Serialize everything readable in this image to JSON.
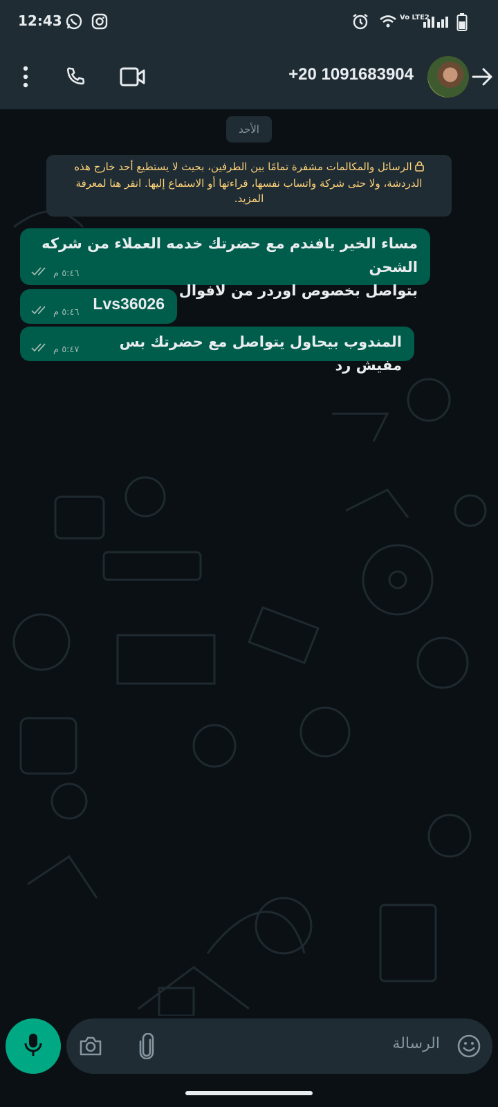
{
  "status_bar": {
    "time": "12:43",
    "left_icons": [
      "whatsapp-icon",
      "instagram-icon"
    ],
    "right_icons": [
      "alarm-icon",
      "wifi-icon",
      "volte-icon",
      "signal-icon",
      "battery-icon"
    ],
    "volte_label": "Vo LTE2"
  },
  "header": {
    "contact": "+20 1091683904",
    "icons": [
      "menu-icon",
      "call-icon",
      "video-call-icon",
      "avatar",
      "back-arrow-icon"
    ]
  },
  "chat": {
    "date_label": "الأحد",
    "encryption_notice": "الرسائل والمكالمات مشفرة تمامًا بين الطرفين، بحيث لا يستطيع أحد خارج هذه الدردشة، ولا حتى شركة واتساب نفسها، قراءتها أو الاستماع إليها. انقر هنا لمعرفة المزيد.",
    "messages": [
      {
        "line1": "مساء الخير يافندم مع حضرتك خدمه العملاء من شركه الشحن",
        "line2": "بتواصل بخصوص اوردر من لافوال",
        "time": "٥:٤٦ م"
      },
      {
        "line1": "Lvs36026",
        "time": "٥:٤٦ م"
      },
      {
        "line1": "المندوب بيحاول يتواصل مع حضرتك بس مفيش رد",
        "time": "٥:٤٧ م"
      }
    ]
  },
  "composer": {
    "placeholder": "الرسالة",
    "icons": [
      "mic-icon",
      "camera-icon",
      "attach-icon",
      "emoji-icon"
    ]
  },
  "colors": {
    "bar": "#1f2c34",
    "background": "#0b1014",
    "outgoing_bubble": "#005c4b",
    "accent": "#00a884",
    "notice_text": "#ffd279"
  }
}
